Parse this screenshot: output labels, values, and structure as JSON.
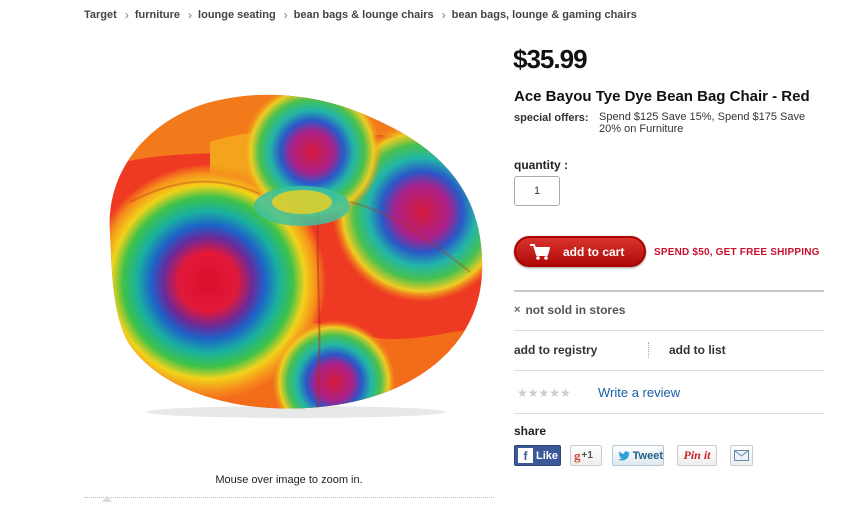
{
  "breadcrumb": [
    "Target",
    "furniture",
    "lounge seating",
    "bean bags & lounge chairs",
    "bean bags, lounge & gaming chairs"
  ],
  "image": {
    "alt": "tie-dye bean bag chair",
    "zoom_hint": "Mouse over image to zoom in."
  },
  "product": {
    "price": "$35.99",
    "title": "Ace Bayou Tye Dye Bean Bag Chair - Red",
    "special_offers_label": "special offers:",
    "special_offers_text": "Spend $125 Save 15%, Spend $175 Save 20% on Furniture"
  },
  "purchase": {
    "quantity_label": "quantity :",
    "quantity_value": "1",
    "add_to_cart_label": "add to cart",
    "free_shipping_text": "SPEND $50, GET FREE SHIPPING",
    "not_sold_label": "not sold in stores",
    "not_sold_mark": "×"
  },
  "actions": {
    "registry_label": "add to registry",
    "list_label": "add to list"
  },
  "reviews": {
    "stars_display": "★★★★★",
    "rating": 0,
    "max_rating": 5,
    "write_review_label": "Write a review"
  },
  "share": {
    "label": "share",
    "facebook_label": "Like",
    "gplus_g": "g",
    "gplus_label": "+1",
    "twitter_label": "Tweet",
    "pinterest_label": "Pin it"
  },
  "colors": {
    "brand_red": "#c8102e",
    "link_blue": "#1a5ea8",
    "facebook_blue": "#3b5998"
  },
  "icons": [
    "chevron-right-icon",
    "cart-icon",
    "close-x-icon",
    "star-icon",
    "facebook-icon",
    "google-plus-icon",
    "twitter-bird-icon",
    "pinterest-icon",
    "email-icon"
  ]
}
